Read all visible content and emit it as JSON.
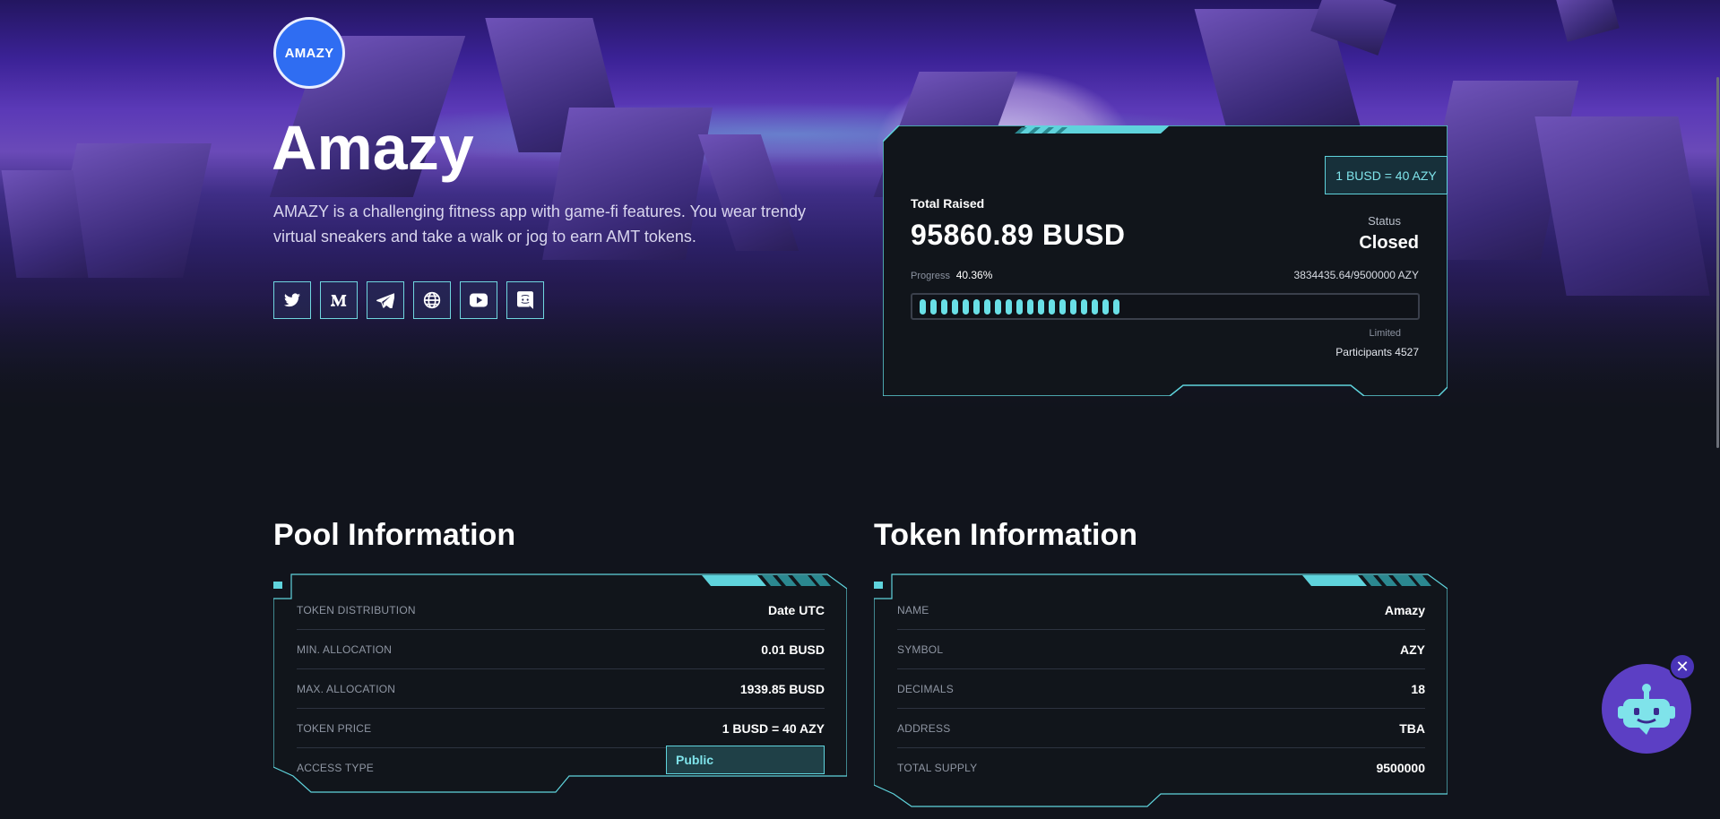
{
  "project": {
    "logo_text": "AMAZY",
    "name": "Amazy",
    "description": "AMAZY is a challenging fitness app with game-fi features. You wear trendy virtual sneakers and take a walk or jog to earn AMT tokens."
  },
  "socials": [
    {
      "icon": "twitter-icon"
    },
    {
      "icon": "medium-icon"
    },
    {
      "icon": "telegram-icon"
    },
    {
      "icon": "globe-icon"
    },
    {
      "icon": "youtube-icon"
    },
    {
      "icon": "discord-icon"
    }
  ],
  "sale": {
    "rate": "1 BUSD = 40 AZY",
    "total_raised_label": "Total Raised",
    "total_raised": "95860.89 BUSD",
    "status_label": "Status",
    "status": "Closed",
    "progress_label": "Progress",
    "progress_text": "40.36%",
    "progress_fraction": 0.4036,
    "tokens": "3834435.64/9500000 AZY",
    "limited_label": "Limited",
    "participants": "Participants 4527"
  },
  "pool": {
    "title": "Pool Information",
    "rows": [
      {
        "k": "TOKEN DISTRIBUTION",
        "v": "Date UTC"
      },
      {
        "k": "MIN. ALLOCATION",
        "v": "0.01 BUSD"
      },
      {
        "k": "MAX. ALLOCATION",
        "v": "1939.85 BUSD"
      },
      {
        "k": "TOKEN PRICE",
        "v": "1 BUSD = 40 AZY"
      },
      {
        "k": "ACCESS TYPE",
        "v": "Public"
      }
    ]
  },
  "token": {
    "title": "Token Information",
    "rows": [
      {
        "k": "NAME",
        "v": "Amazy"
      },
      {
        "k": "SYMBOL",
        "v": "AZY"
      },
      {
        "k": "DECIMALS",
        "v": "18"
      },
      {
        "k": "ADDRESS",
        "v": "TBA"
      },
      {
        "k": "TOTAL SUPPLY",
        "v": "9500000"
      }
    ]
  },
  "chatbot": {
    "icon": "robot-icon",
    "close_icon": "close-icon"
  },
  "colors": {
    "accent": "#69dfe6",
    "background": "#11141c",
    "logo": "#2f6df2",
    "chatbot": "#5c3fc4"
  }
}
